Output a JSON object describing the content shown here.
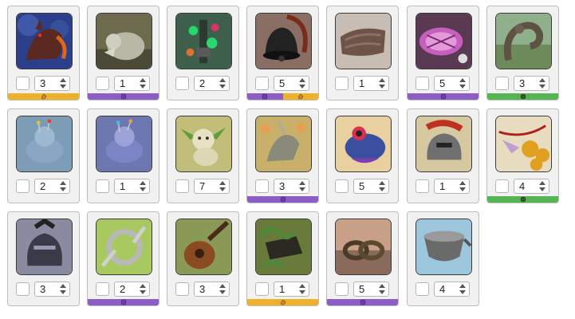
{
  "rows": [
    {
      "items": [
        {
          "qty": "3",
          "art": "beast-art",
          "bar": [
            "gold"
          ]
        },
        {
          "qty": "1",
          "art": "stone-beast-art",
          "bar": [
            "purple"
          ]
        },
        {
          "qty": "2",
          "art": "gem-totem-art",
          "bar": []
        },
        {
          "qty": "5",
          "art": "bell-art",
          "bar": [
            "purple",
            "gold"
          ]
        },
        {
          "qty": "1",
          "art": "rock-slab-art",
          "bar": []
        },
        {
          "qty": "5",
          "art": "crystal-disc-art",
          "bar": [
            "purple"
          ]
        },
        {
          "qty": "3",
          "art": "stone-serpent-art",
          "bar": [
            "green"
          ]
        }
      ]
    },
    {
      "items": [
        {
          "qty": "2",
          "art": "pincushion-mouse-art",
          "bar": []
        },
        {
          "qty": "1",
          "art": "pincushion-mouse-blue-art",
          "bar": []
        },
        {
          "qty": "7",
          "art": "goblin-plush-art",
          "bar": []
        },
        {
          "qty": "3",
          "art": "unicorn-statue-art",
          "bar": [
            "purple"
          ]
        },
        {
          "qty": "5",
          "art": "frog-eye-art",
          "bar": []
        },
        {
          "qty": "1",
          "art": "gladiator-helm-art",
          "bar": []
        },
        {
          "qty": "4",
          "art": "orb-pendant-art",
          "bar": [
            "green"
          ]
        }
      ]
    },
    {
      "items": [
        {
          "qty": "3",
          "art": "knight-helm-art",
          "bar": []
        },
        {
          "qty": "2",
          "art": "ring-blades-art",
          "bar": [
            "purple"
          ]
        },
        {
          "qty": "3",
          "art": "lute-art",
          "bar": []
        },
        {
          "qty": "1",
          "art": "vine-book-art",
          "bar": [
            "gold"
          ]
        },
        {
          "qty": "5",
          "art": "rope-knot-art",
          "bar": [
            "purple"
          ]
        },
        {
          "qty": "4",
          "art": "cauldron-art",
          "bar": []
        }
      ]
    }
  ],
  "colors": {
    "purple": "#8d5cc7",
    "gold": "#f0b12a",
    "green": "#55b552"
  }
}
